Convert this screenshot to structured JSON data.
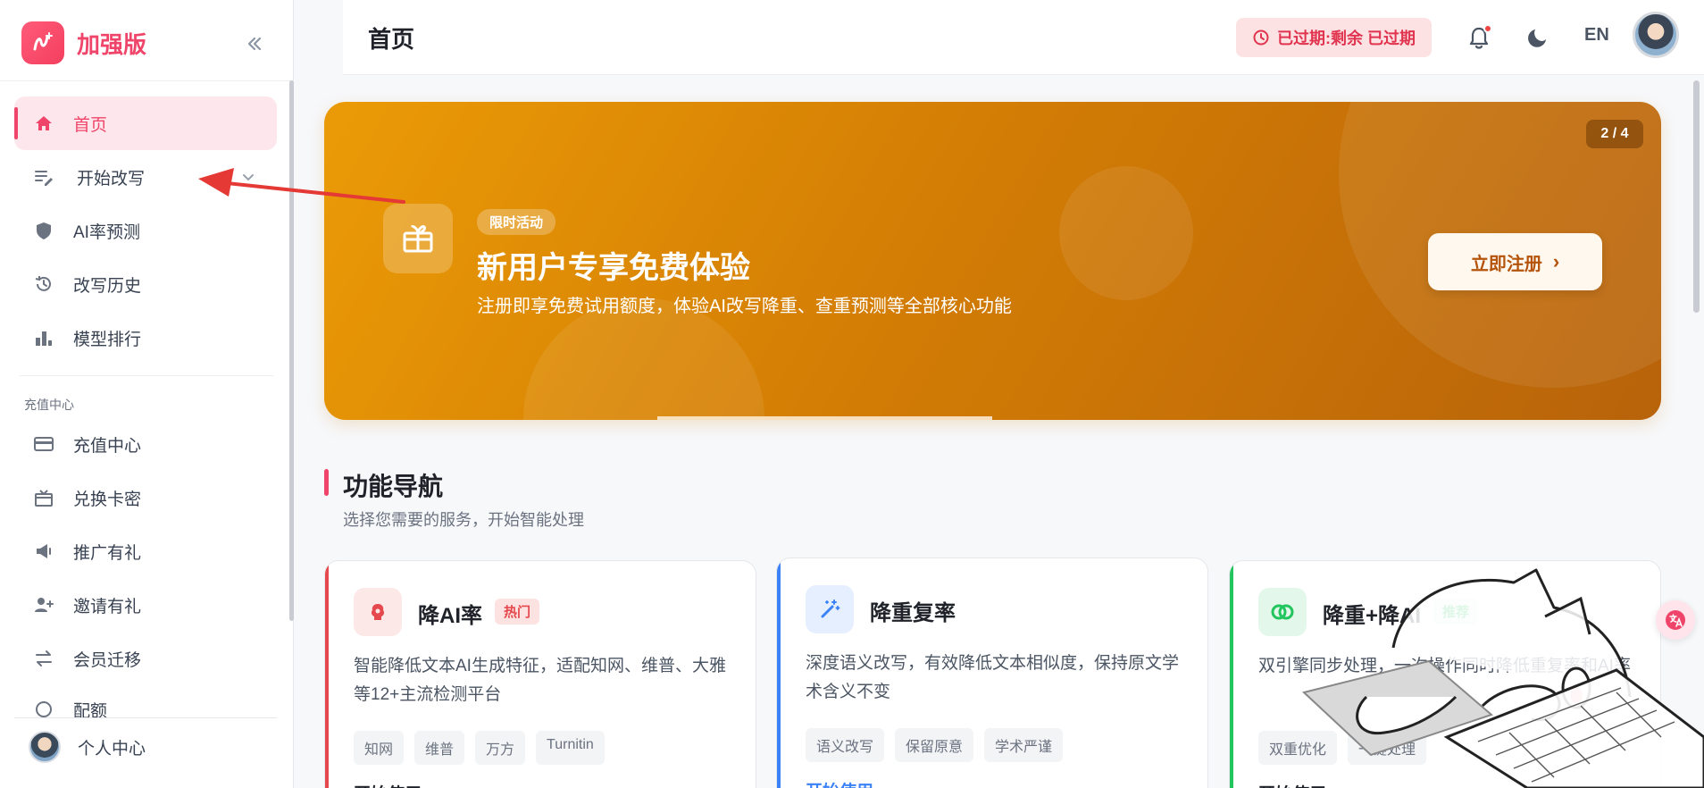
{
  "brand": {
    "name": "加强版"
  },
  "header": {
    "title": "首页",
    "expire_label": "已过期:剩余 已过期",
    "lang": "EN"
  },
  "sidebar": {
    "items": [
      {
        "label": "首页",
        "icon": "home-icon",
        "active": true
      },
      {
        "label": "开始改写",
        "icon": "edit-icon"
      },
      {
        "label": "AI率预测",
        "icon": "shield-icon"
      },
      {
        "label": "改写历史",
        "icon": "history-icon"
      },
      {
        "label": "模型排行",
        "icon": "bar-chart-icon"
      }
    ],
    "section_title": "充值中心",
    "section_items": [
      {
        "label": "充值中心",
        "icon": "credit-card-icon"
      },
      {
        "label": "兑换卡密",
        "icon": "gift-icon"
      },
      {
        "label": "推广有礼",
        "icon": "megaphone-icon"
      },
      {
        "label": "邀请有礼",
        "icon": "user-add-icon"
      },
      {
        "label": "会员迁移",
        "icon": "transfer-icon"
      },
      {
        "label": "配额",
        "icon": "clock-icon"
      }
    ],
    "profile_label": "个人中心"
  },
  "banner": {
    "pager": "2 / 4",
    "tag": "限时活动",
    "title": "新用户专享免费体验",
    "subtitle": "注册即享免费试用额度，体验AI改写降重、查重预测等全部核心功能",
    "cta": "立即注册"
  },
  "features": {
    "title": "功能导航",
    "subtitle": "选择您需要的服务，开始智能处理",
    "cards": [
      {
        "title": "降AI率",
        "badge": "热门",
        "desc": "智能降低文本AI生成特征，适配知网、维普、大雅等12+主流检测平台",
        "chips": [
          "知网",
          "维普",
          "万方",
          "Turnitin"
        ],
        "action": "开始使用",
        "accent": "#e5484d"
      },
      {
        "title": "降重复率",
        "badge": "",
        "desc": "深度语义改写，有效降低文本相似度，保持原文学术含义不变",
        "chips": [
          "语义改写",
          "保留原意",
          "学术严谨"
        ],
        "action": "开始使用",
        "accent": "#3b82f6"
      },
      {
        "title": "降重+降AI",
        "badge": "推荐",
        "desc": "双引擎同步处理，一次操作同时降低重复率和AI率",
        "chips": [
          "双重优化",
          "一键处理"
        ],
        "action": "开始使用",
        "accent": "#22c55e"
      }
    ]
  }
}
